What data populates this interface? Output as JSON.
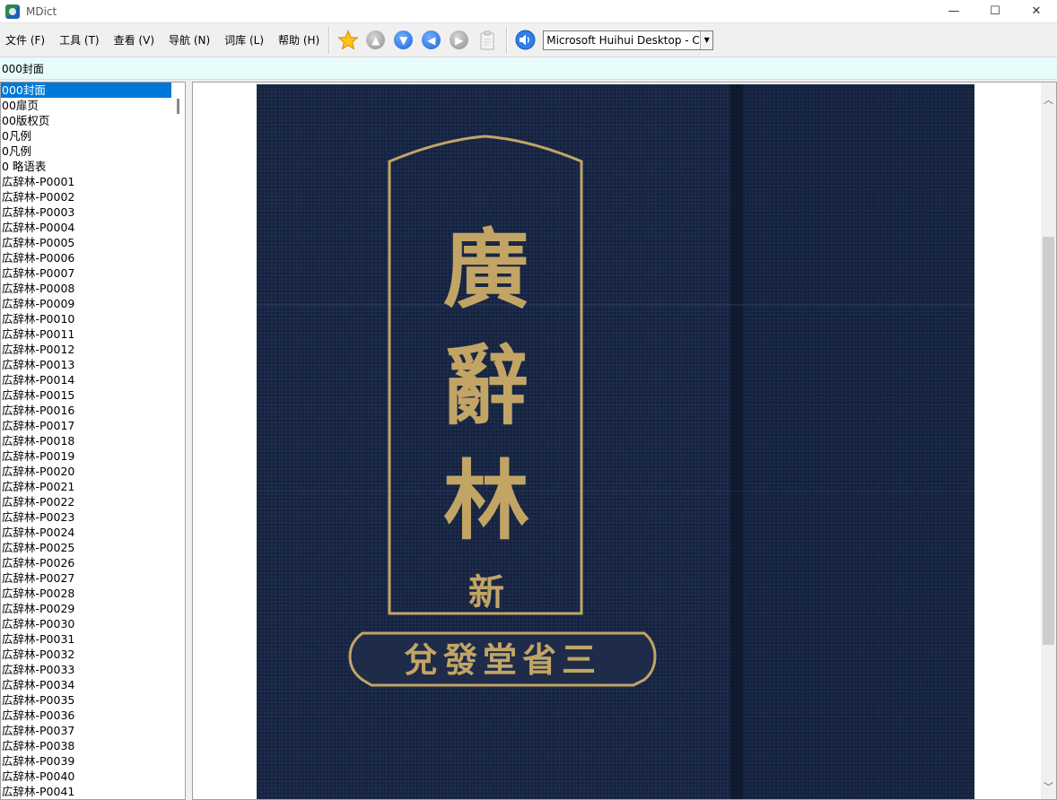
{
  "window": {
    "title": "MDict",
    "minimize": "—",
    "maximize": "☐",
    "close": "✕"
  },
  "menu": [
    "文件 (F)",
    "工具 (T)",
    "查看 (V)",
    "导航 (N)",
    "词库 (L)",
    "帮助 (H)"
  ],
  "toolbar": {
    "icons": [
      "star-icon",
      "arrow-up-icon",
      "arrow-down-icon",
      "arrow-left-icon",
      "arrow-right-icon",
      "clipboard-icon",
      "speaker-icon"
    ],
    "voice_select": "Microsoft Huihui Desktop - C"
  },
  "headword": "000封面",
  "entries": [
    "000封面",
    "00扉页",
    "00版权页",
    "0凡例",
    "0凡例",
    "0 略语表",
    "広辞林-P0001",
    "広辞林-P0002",
    "広辞林-P0003",
    "広辞林-P0004",
    "広辞林-P0005",
    "広辞林-P0006",
    "広辞林-P0007",
    "広辞林-P0008",
    "広辞林-P0009",
    "広辞林-P0010",
    "広辞林-P0011",
    "広辞林-P0012",
    "広辞林-P0013",
    "広辞林-P0014",
    "広辞林-P0015",
    "広辞林-P0016",
    "広辞林-P0017",
    "広辞林-P0018",
    "広辞林-P0019",
    "広辞林-P0020",
    "広辞林-P0021",
    "広辞林-P0022",
    "広辞林-P0023",
    "広辞林-P0024",
    "広辞林-P0025",
    "広辞林-P0026",
    "広辞林-P0027",
    "広辞林-P0028",
    "広辞林-P0029",
    "広辞林-P0030",
    "広辞林-P0031",
    "広辞林-P0032",
    "広辞林-P0033",
    "広辞林-P0034",
    "広辞林-P0035",
    "広辞林-P0036",
    "広辞林-P0037",
    "広辞林-P0038",
    "広辞林-P0039",
    "広辞林-P0040",
    "広辞林-P0041"
  ],
  "cover": {
    "title_chars": [
      "廣",
      "辭",
      "林"
    ],
    "sub_char": "新",
    "publisher": "三省堂發兌",
    "colors": {
      "cloth": "#1b2a48",
      "gold": "#c2a565"
    }
  }
}
